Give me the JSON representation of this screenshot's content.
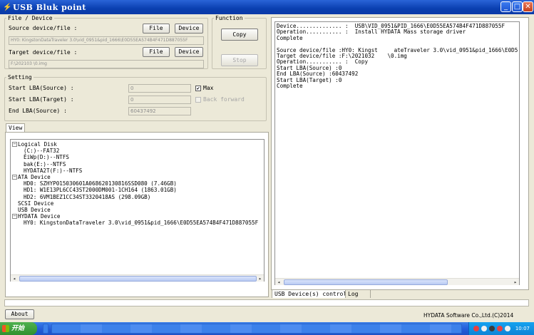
{
  "window": {
    "title": "USB Bluk point"
  },
  "file_device": {
    "legend": "File / Device",
    "source_label": "Source device/file :",
    "source_value": "HY0: KingstonDataTraveler 3.0\\vid_0951&pid_1666\\E0D55EA574B4F471D887055F",
    "target_label": "Target device/file :",
    "target_value": "F:\\202103       \\0.img",
    "file_button": "File",
    "device_button": "Device"
  },
  "function": {
    "legend": "Function",
    "copy_button": "Copy",
    "stop_button": "Stop"
  },
  "setting": {
    "legend": "Setting",
    "start_lba_source_label": "Start LBA(Source) :",
    "start_lba_source_value": "0",
    "start_lba_target_label": "Start LBA(Target) :",
    "start_lba_target_value": "0",
    "end_lba_source_label": "End LBA(Source) :",
    "end_lba_source_value": "60437492",
    "max_label": "Max",
    "max_checked": "✔",
    "back_forward_label": "Back forward"
  },
  "view": {
    "tab_label": "View",
    "tree": [
      {
        "text": "Logical Disk",
        "level": 0,
        "expander": "−"
      },
      {
        "text": "(C:)--FAT32",
        "level": 1
      },
      {
        "text": "ÈiWp(D:)--NTFS",
        "level": 1
      },
      {
        "text": "bak(E:)--NTFS",
        "level": 1
      },
      {
        "text": "HYDATA2T(F:)--NTFS",
        "level": 1
      },
      {
        "text": "ATA Device",
        "level": 0,
        "expander": "−"
      },
      {
        "text": "HD0: SZHYP015030601A068620130816SSD080 (7.46GB)",
        "level": 1
      },
      {
        "text": "HD1: W1E13PL6CC43ST2000DM001-1CH164 (1863.01GB)",
        "level": 1
      },
      {
        "text": "HD2: 6VM1BEZ1CC34ST3320418AS (298.09GB)",
        "level": 1
      },
      {
        "text": "SCSI Device",
        "level": 0
      },
      {
        "text": "USB Device",
        "level": 0
      },
      {
        "text": "HYDATA Device",
        "level": 0,
        "expander": "−"
      },
      {
        "text": "HY0: KingstonDataTraveler 3.0\\vid_0951&pid_1666\\E0D55EA574B4F471D887055F",
        "level": 1
      }
    ]
  },
  "log": {
    "lines": [
      "Device.............. :  USB\\VID_0951&PID_1666\\E0D55EA574B4F471D887055F",
      "Operation........... :  Install HYDATA Mass storage driver",
      "Complete",
      "",
      "Source device/file :HY0: Kingst     ateTraveler 3.0\\vid_0951&pid_1666\\E0D5",
      "Target device/file :F:\\2021032    \\0.img",
      "Operation........... :  Copy",
      "Start LBA(Source) :0",
      "End LBA(Source) :60437492",
      "Start LBA(Target) :0",
      "Complete"
    ],
    "tabs": [
      "USB Device(s) control",
      "Log"
    ]
  },
  "footer": {
    "about_button": "About",
    "copyright": "HYDATA Software Co.,Ltd.(C)2014"
  },
  "taskbar": {
    "start_label": "开始",
    "clock": "10:07"
  }
}
